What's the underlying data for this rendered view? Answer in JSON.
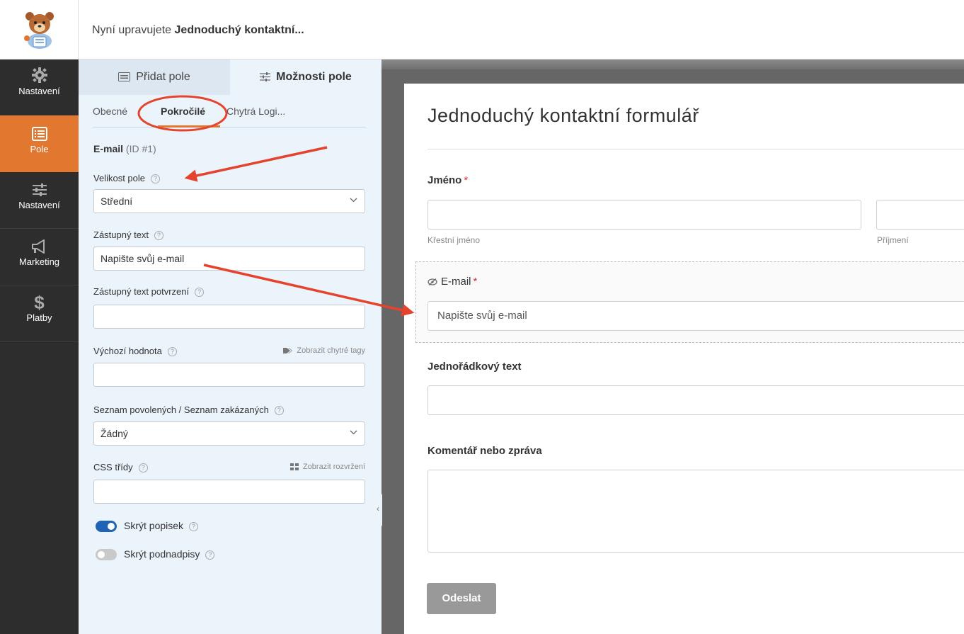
{
  "header": {
    "editing_prefix": "Nyní upravujete ",
    "form_name": "Jednoduchý kontaktní..."
  },
  "leftnav": {
    "items": [
      {
        "label": "Nastavení",
        "icon": "gear-icon",
        "active": false
      },
      {
        "label": "Pole",
        "icon": "fields-list-icon",
        "active": true
      },
      {
        "label": "Nastavení",
        "icon": "sliders-icon",
        "active": false
      },
      {
        "label": "Marketing",
        "icon": "megaphone-icon",
        "active": false
      },
      {
        "label": "Platby",
        "icon": "dollar-icon",
        "active": false
      }
    ],
    "active_color": "#e27730"
  },
  "panel": {
    "tabs": [
      {
        "label": "Přidat pole",
        "icon": "list-icon"
      },
      {
        "label": "Možnosti pole",
        "icon": "sliders-small-icon"
      }
    ],
    "subtabs": [
      {
        "label": "Obecné",
        "active": false
      },
      {
        "label": "Pokročilé",
        "active": true
      },
      {
        "label": "Chytrá Logi...",
        "active": false
      }
    ],
    "field_name": "E-mail",
    "field_id": "(ID #1)",
    "field_size": {
      "label": "Velikost pole",
      "value": "Střední"
    },
    "placeholder": {
      "label": "Zástupný text",
      "value": "Napište svůj e-mail"
    },
    "confirm_placeholder": {
      "label": "Zástupný text potvrzení",
      "value": ""
    },
    "default_value": {
      "label": "Výchozí hodnota",
      "link": "Zobrazit chytré tagy",
      "value": ""
    },
    "allow_deny": {
      "label": "Seznam povolených / Seznam zakázaných",
      "value": "Žádný"
    },
    "css_classes": {
      "label": "CSS třídy",
      "link": "Zobrazit rozvržení",
      "value": ""
    },
    "hide_label": {
      "label": "Skrýt popisek",
      "on": true
    },
    "hide_sublabels": {
      "label": "Skrýt podnadpisy",
      "on": false
    }
  },
  "preview": {
    "title": "Jednoduchý kontaktní formulář",
    "name_label": "Jméno",
    "first_sub": "Křestní jméno",
    "last_sub": "Příjmení",
    "email_label": "E-mail",
    "email_placeholder": "Napište svůj e-mail",
    "single_line_label": "Jednořádkový text",
    "comment_label": "Komentář nebo zpráva",
    "required_mark": "*",
    "submit": "Odeslat"
  },
  "annotation_color": "#e5432d"
}
